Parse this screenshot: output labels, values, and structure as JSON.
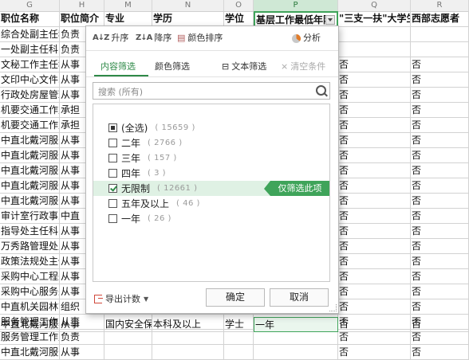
{
  "columns": {
    "letters": [
      "G",
      "H",
      "M",
      "N",
      "O",
      "P",
      "Q",
      "R"
    ],
    "headers": [
      "职位名称",
      "职位简介",
      "专业",
      "学历",
      "学位",
      "基层工作最低年限",
      "\"三支一扶\"大学生",
      "西部志愿者"
    ]
  },
  "rows": [
    {
      "g": "综合处副主任科员",
      "h": "负责",
      "q": "",
      "r": ""
    },
    {
      "g": "一处副主任科员",
      "h": "负责",
      "q": "",
      "r": ""
    },
    {
      "g": "文秘工作主任科员",
      "h": "从事",
      "q": "否",
      "r": "否"
    },
    {
      "g": "文印中心文件印",
      "h": "从事",
      "q": "否",
      "r": "否"
    },
    {
      "g": "行政处房屋管理",
      "h": "从事",
      "q": "否",
      "r": "否"
    },
    {
      "g": "机要交通工作主",
      "h": "承担",
      "q": "否",
      "r": "否"
    },
    {
      "g": "机要交通工作主",
      "h": "承担",
      "q": "否",
      "r": "否"
    },
    {
      "g": "中直北戴河服务",
      "h": "从事",
      "q": "否",
      "r": "否"
    },
    {
      "g": "中直北戴河服务",
      "h": "从事",
      "q": "否",
      "r": "否"
    },
    {
      "g": "中直北戴河服务",
      "h": "从事",
      "q": "否",
      "r": "否"
    },
    {
      "g": "中直北戴河服务",
      "h": "从事",
      "q": "否",
      "r": "否"
    },
    {
      "g": "中直北戴河服务",
      "h": "从事",
      "q": "否",
      "r": "否"
    },
    {
      "g": "审计室行政事业",
      "h": "中直",
      "q": "否",
      "r": "否"
    },
    {
      "g": "指导处主任科员",
      "h": "从事",
      "q": "否",
      "r": "否"
    },
    {
      "g": "万秀路管理处主",
      "h": "从事",
      "q": "否",
      "r": "否"
    },
    {
      "g": "政策法规处主任",
      "h": "从事",
      "q": "否",
      "r": "否"
    },
    {
      "g": "采购中心工程采",
      "h": "从事",
      "q": "否",
      "r": "否"
    },
    {
      "g": "采购中心服务采",
      "h": "从事",
      "q": "否",
      "r": "否"
    },
    {
      "g": "中直机关园林管",
      "h": "组织",
      "q": "否",
      "r": "否"
    },
    {
      "g": "服务管理工作主",
      "h": "从事",
      "q": "否",
      "r": "否"
    },
    {
      "g": "服务管理工作主",
      "h": "负责",
      "q": "否",
      "r": "否"
    },
    {
      "g": "中直北戴河服务",
      "h": "从事",
      "q": "否",
      "r": "否"
    }
  ],
  "last_row": {
    "m": "国内安全保卫",
    "n": "本科及以上",
    "o": "学士",
    "p": "一年"
  },
  "popup": {
    "sort_asc": "升序",
    "sort_desc": "降序",
    "sort_color": "颜色排序",
    "analyze": "分析",
    "tab_content": "内容筛选",
    "tab_color": "颜色筛选",
    "text_filter": "文本筛选",
    "clear_filter": "清空条件",
    "search_placeholder": "搜索 (所有)",
    "items": [
      {
        "label": "(全选)",
        "count": "( 15659 )",
        "state": "partial"
      },
      {
        "label": "二年",
        "count": "( 2766 )",
        "state": "unchecked"
      },
      {
        "label": "三年",
        "count": "( 157 )",
        "state": "unchecked"
      },
      {
        "label": "四年",
        "count": "( 3 )",
        "state": "unchecked"
      },
      {
        "label": "无限制",
        "count": "( 12661 )",
        "state": "checked"
      },
      {
        "label": "五年及以上",
        "count": "( 46 )",
        "state": "unchecked"
      },
      {
        "label": "一年",
        "count": "( 26 )",
        "state": "unchecked"
      }
    ],
    "only_filter_this": "仅筛选此项",
    "export_count": "导出计数",
    "ok": "确定",
    "cancel": "取消"
  }
}
